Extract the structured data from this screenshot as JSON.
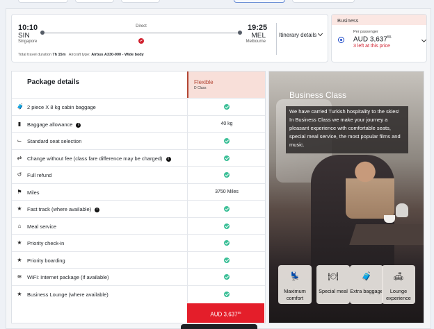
{
  "flight": {
    "departure": {
      "time": "10:10",
      "code": "SIN",
      "city": "Singapore"
    },
    "arrival": {
      "time": "19:25",
      "code": "MEL",
      "city": "Melbourne"
    },
    "stops_label": "Direct",
    "duration_label": "Total travel duration",
    "duration": "7h 15m",
    "aircraft_label": "Aircraft type:",
    "aircraft": "Airbus A330-900 - Wide body",
    "itinerary_label": "Itinerary details"
  },
  "fare": {
    "cabin": "Business",
    "per_passenger_label": "Per passenger",
    "price_main": "AUD 3,637",
    "price_cents": "55",
    "seats_left": "3 left at this price"
  },
  "package": {
    "title": "Package details",
    "column": {
      "name": "Flexible",
      "class": "D Class"
    },
    "rows": [
      {
        "icon": "baggage-icon",
        "glyph": "🧳",
        "label": "2 piece X 8 kg cabin baggage",
        "info": false,
        "value": "check"
      },
      {
        "icon": "suitcase-icon",
        "glyph": "▮",
        "label": "Baggage allowance",
        "info": true,
        "value": "40 kg"
      },
      {
        "icon": "seat-icon",
        "glyph": "⌙",
        "label": "Standard seat selection",
        "info": false,
        "value": "check"
      },
      {
        "icon": "change-icon",
        "glyph": "⇄",
        "label": "Change without fee (class fare difference may be charged)",
        "info": true,
        "value": "check"
      },
      {
        "icon": "refund-icon",
        "glyph": "↺",
        "label": "Full refund",
        "info": false,
        "value": "check"
      },
      {
        "icon": "miles-icon",
        "glyph": "⚑",
        "label": "Miles",
        "info": false,
        "value": "3750 Miles"
      },
      {
        "icon": "star-icon",
        "glyph": "★",
        "label": "Fast track (where available)",
        "info": true,
        "value": "check"
      },
      {
        "icon": "meal-icon",
        "glyph": "⌂",
        "label": "Meal service",
        "info": false,
        "value": "check"
      },
      {
        "icon": "star-icon",
        "glyph": "★",
        "label": "Priority check-in",
        "info": false,
        "value": "check"
      },
      {
        "icon": "star-icon",
        "glyph": "★",
        "label": "Priority boarding",
        "info": false,
        "value": "check"
      },
      {
        "icon": "wifi-icon",
        "glyph": "≋",
        "label": "WiFi: Internet package (if available)",
        "info": false,
        "value": "check"
      },
      {
        "icon": "star-icon",
        "glyph": "★",
        "label": "Business Lounge (where available)",
        "info": false,
        "value": "check"
      }
    ],
    "button_price": "AUD 3,637",
    "button_cents": "55"
  },
  "promo": {
    "title": "Business Class",
    "text": "We have carried Turkish hospitality to the skies! In Business Class we make your journey a pleasant experience with comfortable seats, special meal service, the most popular films and music.",
    "features": [
      {
        "icon": "comfort-seat-icon",
        "glyph": "💺",
        "label": "Maximum comfort"
      },
      {
        "icon": "special-meal-icon",
        "glyph": "🍽",
        "label": "Special meal"
      },
      {
        "icon": "extra-baggage-icon",
        "glyph": "🧳",
        "label": "Extra baggage"
      },
      {
        "icon": "lounge-icon",
        "glyph": "🛋",
        "label": "Lounge experience"
      }
    ]
  },
  "colors": {
    "accent": "#e41e2a",
    "check": "#3bbf97",
    "flexible": "#b24533"
  }
}
